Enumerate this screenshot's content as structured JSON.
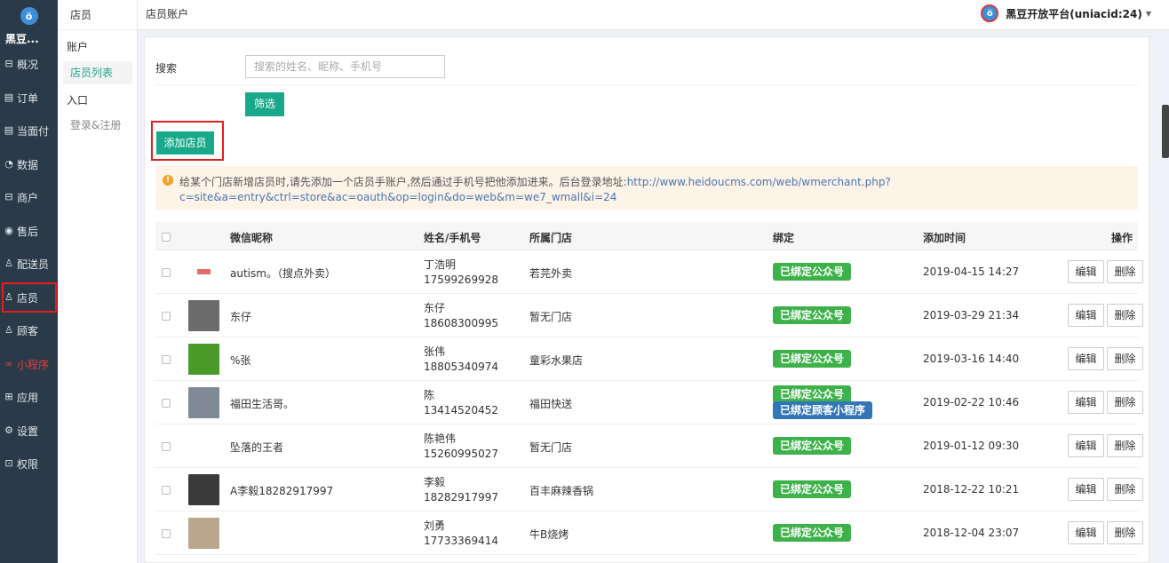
{
  "app": {
    "brand": "黑豆...",
    "account": "黑豆开放平台(uniacid:24)"
  },
  "nav": [
    {
      "label": "概况",
      "icon": "dashboard-icon",
      "glyph": "⊟"
    },
    {
      "label": "订单",
      "icon": "order-icon",
      "glyph": "▤"
    },
    {
      "label": "当面付",
      "icon": "pay-icon",
      "glyph": "▤"
    },
    {
      "label": "数据",
      "icon": "chart-icon",
      "glyph": "◔"
    },
    {
      "label": "商户",
      "icon": "shop-icon",
      "glyph": "⊟"
    },
    {
      "label": "售后",
      "icon": "service-icon",
      "glyph": "◉"
    },
    {
      "label": "配送员",
      "icon": "rider-icon",
      "glyph": "♙"
    },
    {
      "label": "店员",
      "icon": "clerk-icon",
      "glyph": "♙"
    },
    {
      "label": "顾客",
      "icon": "customer-icon",
      "glyph": "♙"
    },
    {
      "label": "小程序",
      "icon": "miniapp-icon",
      "glyph": "∞"
    },
    {
      "label": "应用",
      "icon": "apps-icon",
      "glyph": "⊞"
    },
    {
      "label": "设置",
      "icon": "settings-icon",
      "glyph": "⚙"
    },
    {
      "label": "权限",
      "icon": "lock-icon",
      "glyph": "⊡"
    }
  ],
  "sub": {
    "title": "店员",
    "group1": "账户",
    "link_list": "店员列表",
    "group2": "入口",
    "link_login": "登录&注册"
  },
  "breadcrumb": "店员账户",
  "search": {
    "label": "搜索",
    "placeholder": "搜索的姓名、昵称、手机号",
    "value": ""
  },
  "buttons": {
    "filter": "筛选",
    "add": "添加店员",
    "edit": "编辑",
    "delete": "删除"
  },
  "notice": {
    "text": "给某个门店新增店员时,请先添加一个店员手账户,然后通过手机号把他添加进来。后台登录地址:",
    "url1": "http://www.heidoucms.com/web/wmerchant.php?",
    "url2": "c=site&a=entry&ctrl=store&ac=oauth&op=login&do=web&m=we7_wmall&i=24"
  },
  "table": {
    "headers": {
      "nickname": "微信昵称",
      "name_phone": "姓名/手机号",
      "store": "所属门店",
      "bind": "绑定",
      "time": "添加时间",
      "ops": "操作"
    },
    "rows": [
      {
        "nickname": "autism。（搜点外卖）",
        "name": "丁浩明",
        "phone": "17599269928",
        "store": "若芫外卖",
        "tags": [
          "已绑定公众号"
        ],
        "time": "2019-04-15 14:27",
        "avatar": "#f4f4f4"
      },
      {
        "nickname": "东仔",
        "name": "东仔",
        "phone": "18608300995",
        "store": "暂无门店",
        "tags": [
          "已绑定公众号"
        ],
        "time": "2019-03-29 21:34",
        "avatar": "#6b6b6b"
      },
      {
        "nickname": "%张",
        "name": "张伟",
        "phone": "18805340974",
        "store": "童彩水果店",
        "tags": [
          "已绑定公众号"
        ],
        "time": "2019-03-16 14:40",
        "avatar": "#4a9a2a"
      },
      {
        "nickname": "福田生活哥。",
        "name": "陈",
        "phone": "13414520452",
        "store": "福田快送",
        "tags": [
          "已绑定公众号",
          "已绑定顾客小程序"
        ],
        "time": "2019-02-22 10:46",
        "avatar": "#7f8a96"
      },
      {
        "nickname": "坠落的王者",
        "name": "陈艳伟",
        "phone": "15260995027",
        "store": "暂无门店",
        "tags": [
          "已绑定公众号"
        ],
        "time": "2019-01-12 09:30",
        "avatar": "#ffffff"
      },
      {
        "nickname": "A李毅18282917997",
        "name": "李毅",
        "phone": "18282917997",
        "store": "百丰麻辣香锅",
        "tags": [
          "已绑定公众号"
        ],
        "time": "2018-12-22 10:21",
        "avatar": "#3a3a3a"
      },
      {
        "nickname": "",
        "name": "刘勇",
        "phone": "17733369414",
        "store": "牛B烧烤",
        "tags": [
          "已绑定公众号"
        ],
        "time": "2018-12-04 23:07",
        "avatar": "#b9a68c"
      }
    ]
  },
  "colors": {
    "accent": "#19a98a",
    "tag_green": "#3db14a",
    "tag_blue": "#3276b8",
    "nav_bg": "#2b3a48",
    "highlight": "#e01e1e"
  }
}
